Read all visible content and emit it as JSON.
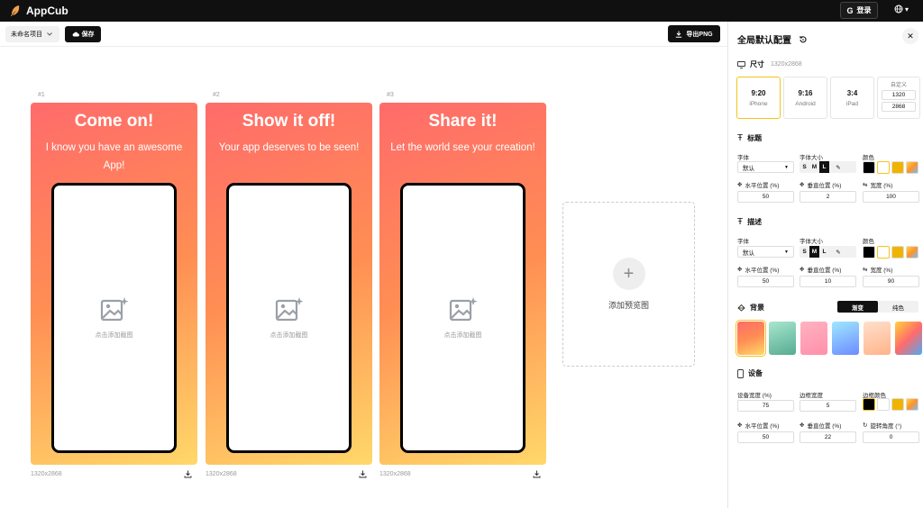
{
  "app": {
    "title": "AppCub",
    "login_label": "登录",
    "lang_caret": "▾"
  },
  "toolbar": {
    "project_name": "未命名项目",
    "save_label": "保存",
    "export_label": "导出PNG"
  },
  "cards": [
    {
      "num": "#1",
      "title": "Come on!",
      "desc": "I know you have an awesome App!",
      "placeholder": "点击添加截图",
      "size": "1320x2868"
    },
    {
      "num": "#2",
      "title": "Show it off!",
      "desc": "Your app deserves to be seen!",
      "placeholder": "点击添加截图",
      "size": "1320x2868"
    },
    {
      "num": "#3",
      "title": "Share it!",
      "desc": "Let the world see your creation!",
      "placeholder": "点击添加截图",
      "size": "1320x2868"
    }
  ],
  "add_preview_label": "添加预览图",
  "panel": {
    "title": "全局默认配置",
    "size": {
      "label": "尺寸",
      "value": "1320x2868",
      "options": [
        {
          "ratio": "9:20",
          "device": "iPhone",
          "selected": true
        },
        {
          "ratio": "9:16",
          "device": "Android",
          "selected": false
        },
        {
          "ratio": "3:4",
          "device": "iPad",
          "selected": false
        }
      ],
      "custom_label": "自定义",
      "custom_w": "1320",
      "custom_h": "2868"
    },
    "title_sec": {
      "label": "标题",
      "font_label": "字体",
      "font_value": "默认",
      "size_label": "字体大小",
      "color_label": "颜色",
      "sizes": [
        "S",
        "M",
        "L"
      ],
      "size_selected": "L",
      "hpos_label": "水平位置 (%)",
      "vpos_label": "垂直位置 (%)",
      "width_label": "宽度 (%)",
      "hpos": "50",
      "vpos": "2",
      "width": "100"
    },
    "desc_sec": {
      "label": "描述",
      "font_label": "字体",
      "font_value": "默认",
      "size_label": "字体大小",
      "color_label": "颜色",
      "sizes": [
        "S",
        "M",
        "L"
      ],
      "size_selected": "S",
      "hpos_label": "水平位置 (%)",
      "vpos_label": "垂直位置 (%)",
      "width_label": "宽度 (%)",
      "hpos": "50",
      "vpos": "10",
      "width": "90"
    },
    "bg_sec": {
      "label": "背景",
      "tab_gradient": "渐变",
      "tab_solid": "纯色"
    },
    "device_sec": {
      "label": "设备",
      "width_label": "设备宽度 (%)",
      "border_label": "边框宽度",
      "color_label": "边框颜色",
      "width": "75",
      "border": "5",
      "hpos_label": "水平位置 (%)",
      "vpos_label": "垂直位置 (%)",
      "rot_label": "旋转角度 (°)",
      "hpos": "50",
      "vpos": "22",
      "rot": "0"
    }
  },
  "colors": {
    "accent": "#f5c518",
    "dark": "#111111",
    "card_gradient": [
      "#ff6b6b",
      "#ff8e53",
      "#ffd86a"
    ]
  }
}
